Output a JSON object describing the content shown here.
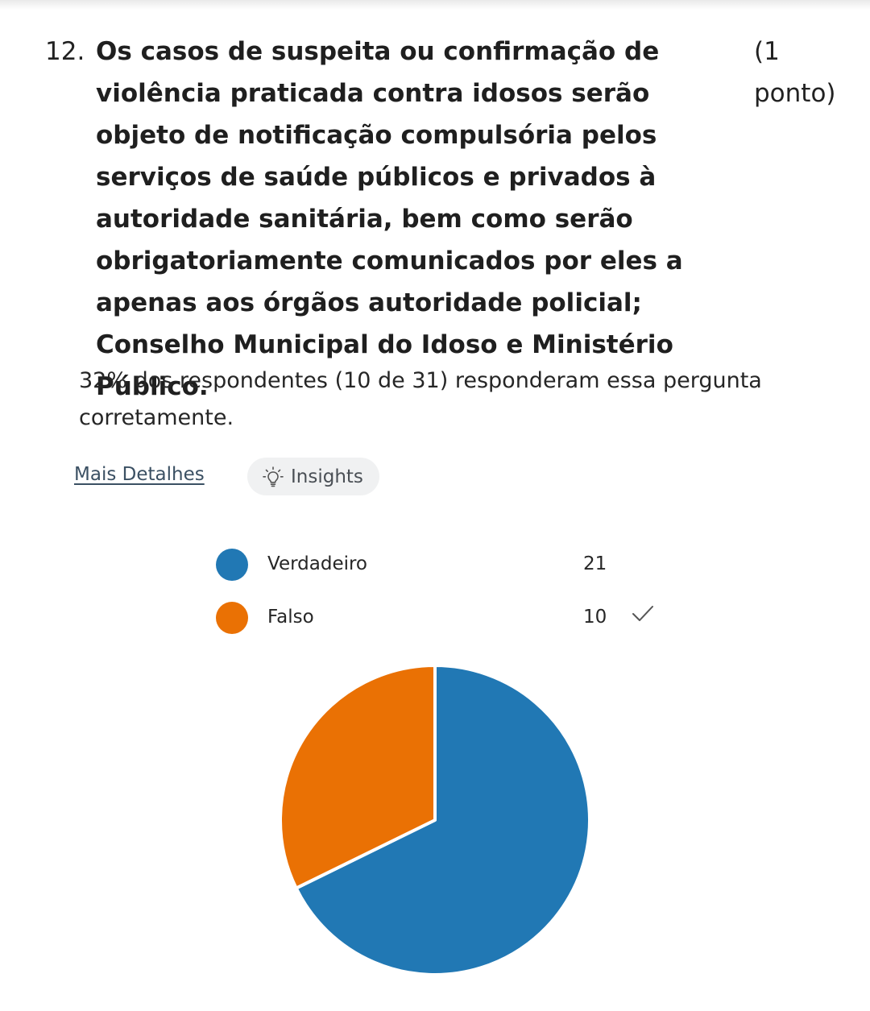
{
  "question": {
    "number": "12.",
    "text": "Os casos de suspeita ou confirmação de violência praticada contra idosos serão objeto de notificação compulsória pelos serviços de saúde públicos e privados à autoridade sanitária, bem como serão obrigatoriamente comunicados por eles a apenas aos órgãos autoridade policial; Conselho Municipal do Idoso e Ministério Público.",
    "points": "(1 ponto)"
  },
  "summary": "32% dos respondentes (10 de 31) responderam essa pergunta corretamente.",
  "actions": {
    "more_details": "Mais Detalhes",
    "insights": "Insights"
  },
  "icons": {
    "insights": "lightbulb-icon",
    "correct": "checkmark-icon"
  },
  "colors": {
    "verdadeiro": "#2178b4",
    "falso": "#ea7104"
  },
  "chart_data": {
    "type": "pie",
    "categories": [
      "Verdadeiro",
      "Falso"
    ],
    "values": [
      21,
      10
    ],
    "correct": "Falso",
    "legend_position": "top"
  }
}
